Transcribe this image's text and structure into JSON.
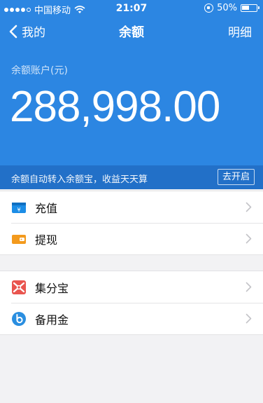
{
  "status_bar": {
    "carrier": "中国移动",
    "time": "21:07",
    "battery": "50%"
  },
  "nav": {
    "back_label": "我的",
    "title": "余额",
    "right_label": "明细"
  },
  "balance": {
    "label": "余额账户(元)",
    "amount": "288,998.00"
  },
  "promo": {
    "text": "余额自动转入余额宝，收益天天算",
    "button": "去开启"
  },
  "menu_group_1": [
    {
      "label": "充值",
      "icon": "recharge-icon"
    },
    {
      "label": "提现",
      "icon": "withdraw-icon"
    }
  ],
  "menu_group_2": [
    {
      "label": "集分宝",
      "icon": "jifenbao-icon"
    },
    {
      "label": "备用金",
      "icon": "beiyongjin-icon"
    }
  ],
  "colors": {
    "header_blue": "#2c86e2",
    "promo_blue": "#2270c8",
    "background": "#f2f2f4"
  }
}
